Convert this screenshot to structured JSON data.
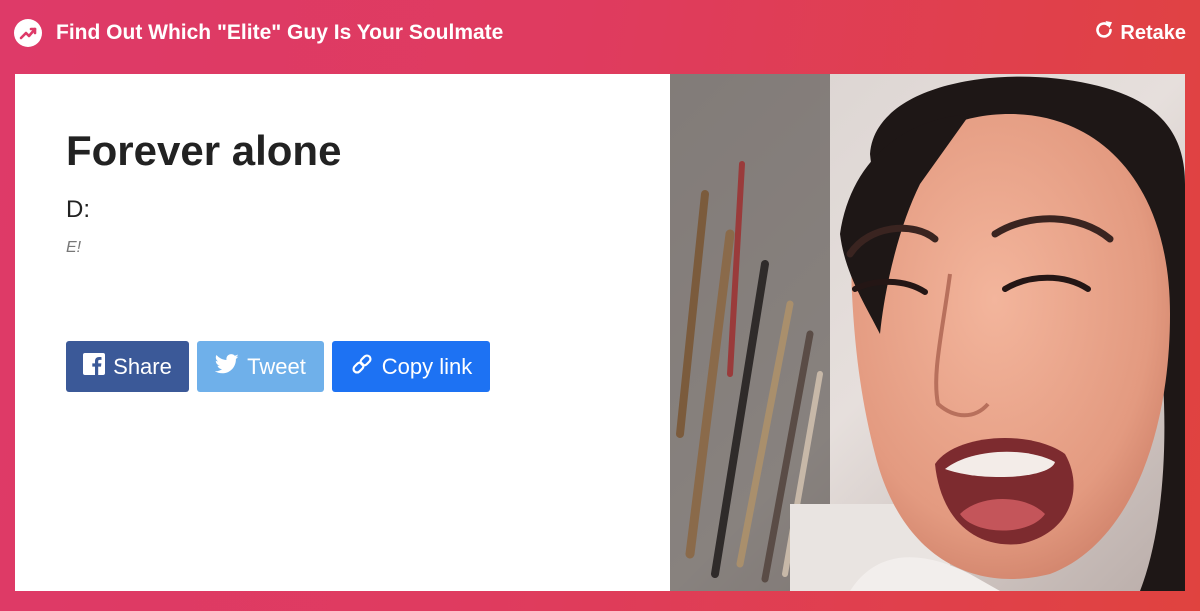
{
  "header": {
    "title": "Find Out Which \"Elite\" Guy Is Your Soulmate",
    "retake_label": "Retake",
    "brand_icon": "trending-arrow-icon",
    "retake_icon": "refresh-icon"
  },
  "result": {
    "title": "Forever alone",
    "description": "D:",
    "image_credit": "E!"
  },
  "share": {
    "facebook_label": "Share",
    "twitter_label": "Tweet",
    "copy_label": "Copy link",
    "facebook_icon": "facebook-icon",
    "twitter_icon": "twitter-icon",
    "copy_icon": "link-icon"
  },
  "colors": {
    "background_gradient_start": "#de3a68",
    "background_gradient_end": "#e0433f",
    "facebook": "#3b5998",
    "twitter": "#6fb0ea",
    "copy_link": "#1d72f3",
    "title_text": "#222222",
    "credit_text": "#777777"
  }
}
